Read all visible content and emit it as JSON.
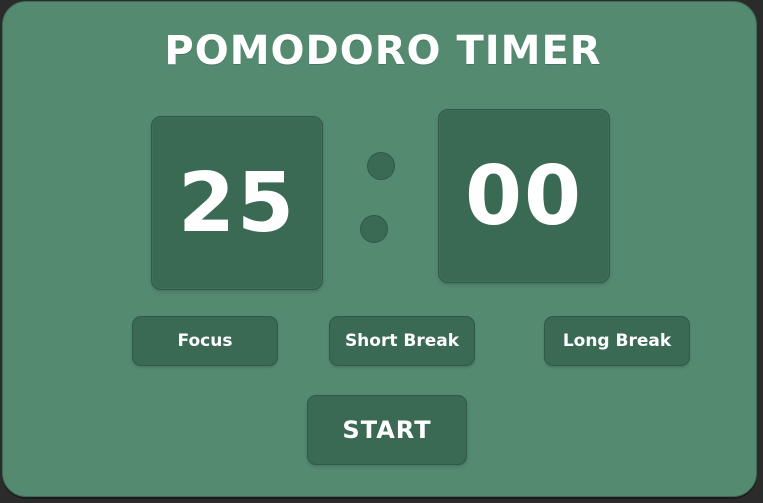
{
  "app": {
    "title": "POMODORO TIMER"
  },
  "timer": {
    "minutes": "25",
    "seconds": "00"
  },
  "modes": [
    {
      "label": "Focus"
    },
    {
      "label": "Short Break"
    },
    {
      "label": "Long Break"
    }
  ],
  "controls": {
    "start_label": "START"
  },
  "colors": {
    "background": "#548a70",
    "panel": "#3a6a53",
    "text": "#ffffff"
  }
}
